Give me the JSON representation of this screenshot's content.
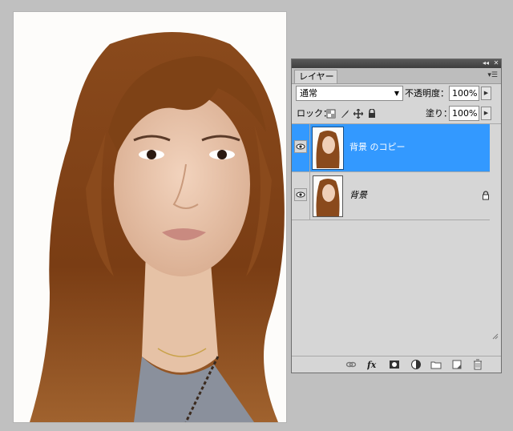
{
  "panel": {
    "tab_label": "レイヤー",
    "panel_menu_glyph": "▾☰",
    "collapse_glyph": "◂◂",
    "close_glyph": "✕"
  },
  "blend": {
    "mode": "通常",
    "opacity_label": "不透明度：",
    "opacity_value": "100%",
    "fill_label": "塗り：",
    "fill_value": "100%"
  },
  "lock": {
    "label": "ロック："
  },
  "layers": [
    {
      "name": "背景 のコピー",
      "selected": true,
      "visible": true,
      "locked": false
    },
    {
      "name": "背景",
      "selected": false,
      "visible": true,
      "locked": true
    }
  ],
  "bottom_tools": [
    "link-layers-icon",
    "layer-style-fx-icon",
    "layer-mask-icon",
    "adjustment-layer-icon",
    "new-group-icon",
    "new-layer-icon",
    "delete-layer-icon"
  ],
  "colors": {
    "selection": "#3399ff",
    "panel_bg": "#d6d6d6",
    "workspace_bg": "#c0c0c0"
  }
}
